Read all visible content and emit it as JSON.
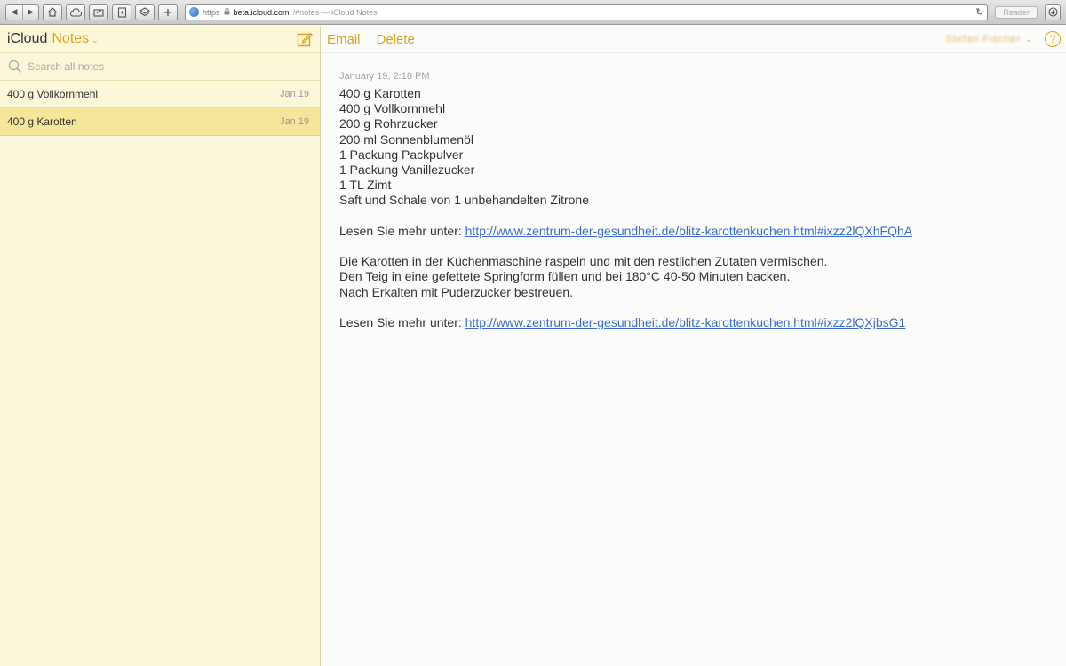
{
  "browser": {
    "https_label": "https",
    "domain": "beta.icloud.com",
    "path": "/#notes — iCloud Notes",
    "reader_label": "Reader",
    "back_icon": "back-arrow-icon",
    "forward_icon": "forward-arrow-icon"
  },
  "sidebar": {
    "brand": "iCloud",
    "folder": "Notes",
    "search_placeholder": "Search all notes",
    "notes": [
      {
        "title": "400 g Vollkornmehl",
        "date": "Jan 19"
      },
      {
        "title": "400 g Karotten",
        "date": "Jan 19"
      }
    ],
    "selected_index": 1,
    "accent_color": "#d9a51d",
    "selected_color": "#f6e69b",
    "background_color": "#fbf7d8"
  },
  "toolbar": {
    "email_label": "Email",
    "delete_label": "Delete",
    "account_name": "Stefan Fischer",
    "help_label": "?"
  },
  "note": {
    "timestamp": "January 19, 2:18 PM",
    "ingredients": [
      "400 g Karotten",
      "400 g Vollkornmehl",
      "200 g Rohrzucker",
      "200 ml Sonnenblumenöl",
      "1 Packung Packpulver",
      "1 Packung Vanillezucker",
      "1 TL Zimt",
      "Saft und Schale von 1 unbehandelten Zitrone"
    ],
    "read_more_prefix": "Lesen Sie mehr unter: ",
    "link1": "http://www.zentrum-der-gesundheit.de/blitz-karottenkuchen.html#ixzz2lQXhFQhA",
    "instructions": [
      "Die Karotten in der Küchenmaschine raspeln und mit den restlichen Zutaten vermischen.",
      "Den Teig in eine gefettete Springform füllen und bei 180°C 40-50 Minuten backen.",
      "Nach Erkalten mit Puderzucker bestreuen."
    ],
    "link2": "http://www.zentrum-der-gesundheit.de/blitz-karottenkuchen.html#ixzz2lQXjbsG1"
  }
}
